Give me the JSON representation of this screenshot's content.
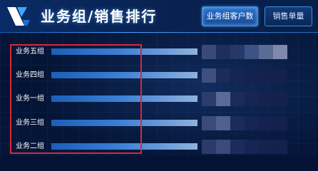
{
  "header": {
    "title": "业务组/销售排行",
    "tabs": [
      {
        "label": "业务组客户数",
        "active": true
      },
      {
        "label": "销售单量",
        "active": false
      }
    ]
  },
  "ranking": {
    "rows": [
      {
        "label": "业务五组",
        "share": 1.0,
        "tiles": [
          "#3a4a78",
          "#1e2f5e",
          "#26386a",
          "#3d5384",
          "#5a6b96",
          "#7d89ad"
        ]
      },
      {
        "label": "业务四组",
        "share": 1.0,
        "tiles": [
          "#3f507e",
          "#1b2c5a",
          "#162553",
          "#142250",
          "#13214e",
          "#13214e"
        ]
      },
      {
        "label": "业务一组",
        "share": 1.0,
        "tiles": [
          "#2c3d6c",
          "#5a6b96",
          "#1b2c5a",
          "#162553",
          "#142250",
          "#13214e"
        ]
      },
      {
        "label": "业务三组",
        "share": 1.0,
        "tiles": [
          "#3a4b7a",
          "#4e608d",
          "#1b2c5a",
          "#162553",
          "#142250",
          "#13214e"
        ]
      },
      {
        "label": "业务二组",
        "share": 1.0,
        "tiles": [
          "#2a3b6a",
          "#3a4b7a",
          "#1b2c5a",
          "#162553",
          "#142250",
          "#13214e"
        ]
      }
    ]
  },
  "colors": {
    "accent": "#3f8fe0",
    "highlight": "#d8283a",
    "bar_start": "#1a5fb8",
    "bar_end": "#8fb1dc"
  },
  "icons": {
    "logo": "app-logo-icon"
  }
}
